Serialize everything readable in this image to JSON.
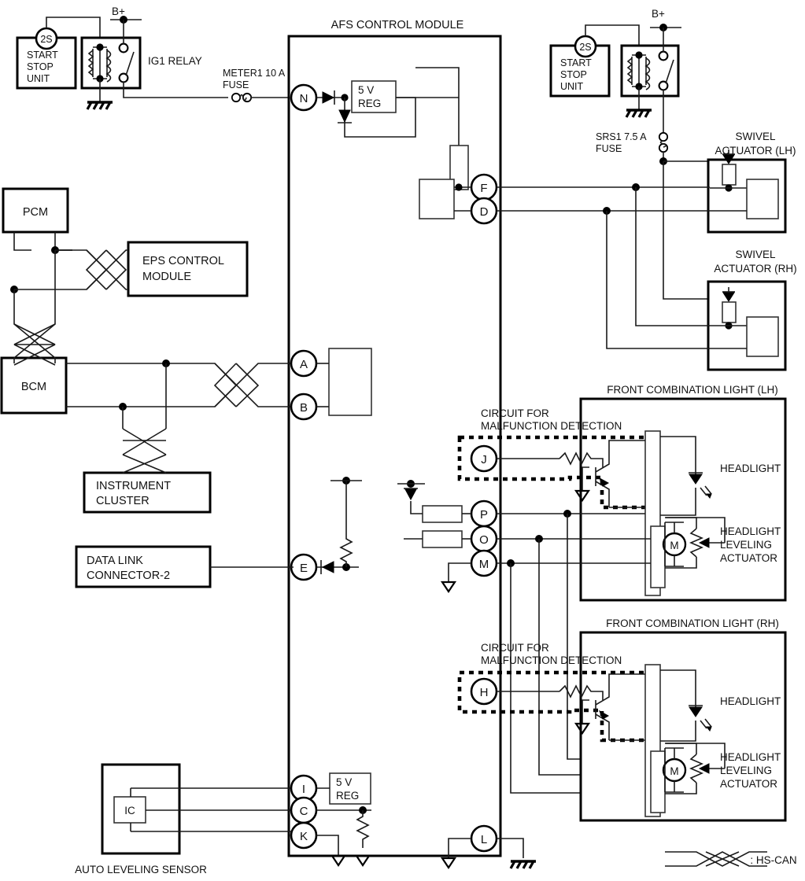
{
  "diagram": {
    "title": "AFS CONTROL MODULE",
    "type": "automotive-wiring-diagram",
    "legend": {
      "symbol": "twisted-pair-wire",
      "label": ": HS-CAN"
    }
  },
  "power": {
    "battery_left_label": "B+",
    "battery_right_label": "B+",
    "fuse_meter": "METER1 10 A\nFUSE",
    "fuse_meter_line1": "METER1 10 A",
    "fuse_meter_line2": "FUSE",
    "fuse_srs": "SRS1 7.5 A\nFUSE",
    "fuse_srs_line1": "SRS1 7.5 A",
    "fuse_srs_line2": "FUSE",
    "relay_label": "IG1 RELAY"
  },
  "start_stop_units": [
    {
      "id": "start-stop-unit-left",
      "line1": "START",
      "line2": "STOP",
      "line3": "UNIT",
      "connector": "2S"
    },
    {
      "id": "start-stop-unit-right",
      "line1": "START",
      "line2": "STOP",
      "line3": "UNIT",
      "connector": "2S"
    }
  ],
  "left_modules": [
    {
      "id": "pcm",
      "label": "PCM"
    },
    {
      "id": "eps-control-module",
      "line1": "EPS CONTROL",
      "line2": "MODULE"
    },
    {
      "id": "bcm",
      "label": "BCM"
    },
    {
      "id": "instrument-cluster",
      "line1": "INSTRUMENT",
      "line2": "CLUSTER"
    },
    {
      "id": "data-link-connector-2",
      "line1": "DATA LINK",
      "line2": "CONNECTOR-2"
    },
    {
      "id": "auto-leveling-sensor",
      "label": "AUTO LEVELING SENSOR",
      "inner": "IC"
    }
  ],
  "terminals": [
    {
      "id": "N",
      "label": "N"
    },
    {
      "id": "F",
      "label": "F"
    },
    {
      "id": "D",
      "label": "D"
    },
    {
      "id": "A",
      "label": "A"
    },
    {
      "id": "B",
      "label": "B"
    },
    {
      "id": "J",
      "label": "J"
    },
    {
      "id": "P",
      "label": "P"
    },
    {
      "id": "O",
      "label": "O"
    },
    {
      "id": "M",
      "label": "M"
    },
    {
      "id": "E",
      "label": "E"
    },
    {
      "id": "H",
      "label": "H"
    },
    {
      "id": "I",
      "label": "I"
    },
    {
      "id": "C",
      "label": "C"
    },
    {
      "id": "K",
      "label": "K"
    },
    {
      "id": "L",
      "label": "L"
    }
  ],
  "regulators": [
    {
      "id": "reg-top",
      "line1": "5 V",
      "line2": "REG"
    },
    {
      "id": "reg-bottom",
      "line1": "5 V",
      "line2": "REG"
    }
  ],
  "actuators": [
    {
      "id": "swivel-actuator-lh",
      "line1": "SWIVEL",
      "line2": "ACTUATOR (LH)"
    },
    {
      "id": "swivel-actuator-rh",
      "line1": "SWIVEL",
      "line2": "ACTUATOR (RH)"
    }
  ],
  "lights": [
    {
      "id": "front-combination-light-lh",
      "title": "FRONT COMBINATION LIGHT (LH)",
      "headlight": "HEADLIGHT",
      "actuator_line1": "HEADLIGHT",
      "actuator_line2": "LEVELING",
      "actuator_line3": "ACTUATOR",
      "motor": "M",
      "detection_line1": "CIRCUIT FOR",
      "detection_line2": "MALFUNCTION DETECTION",
      "detection_terminal": "J"
    },
    {
      "id": "front-combination-light-rh",
      "title": "FRONT COMBINATION LIGHT (RH)",
      "headlight": "HEADLIGHT",
      "actuator_line1": "HEADLIGHT",
      "actuator_line2": "LEVELING",
      "actuator_line3": "ACTUATOR",
      "motor": "M",
      "detection_line1": "CIRCUIT FOR",
      "detection_line2": "MALFUNCTION DETECTION",
      "detection_terminal": "H"
    }
  ],
  "colors": {
    "line": "#1a1a1a",
    "heavy": "#000000",
    "background": "#ffffff"
  }
}
